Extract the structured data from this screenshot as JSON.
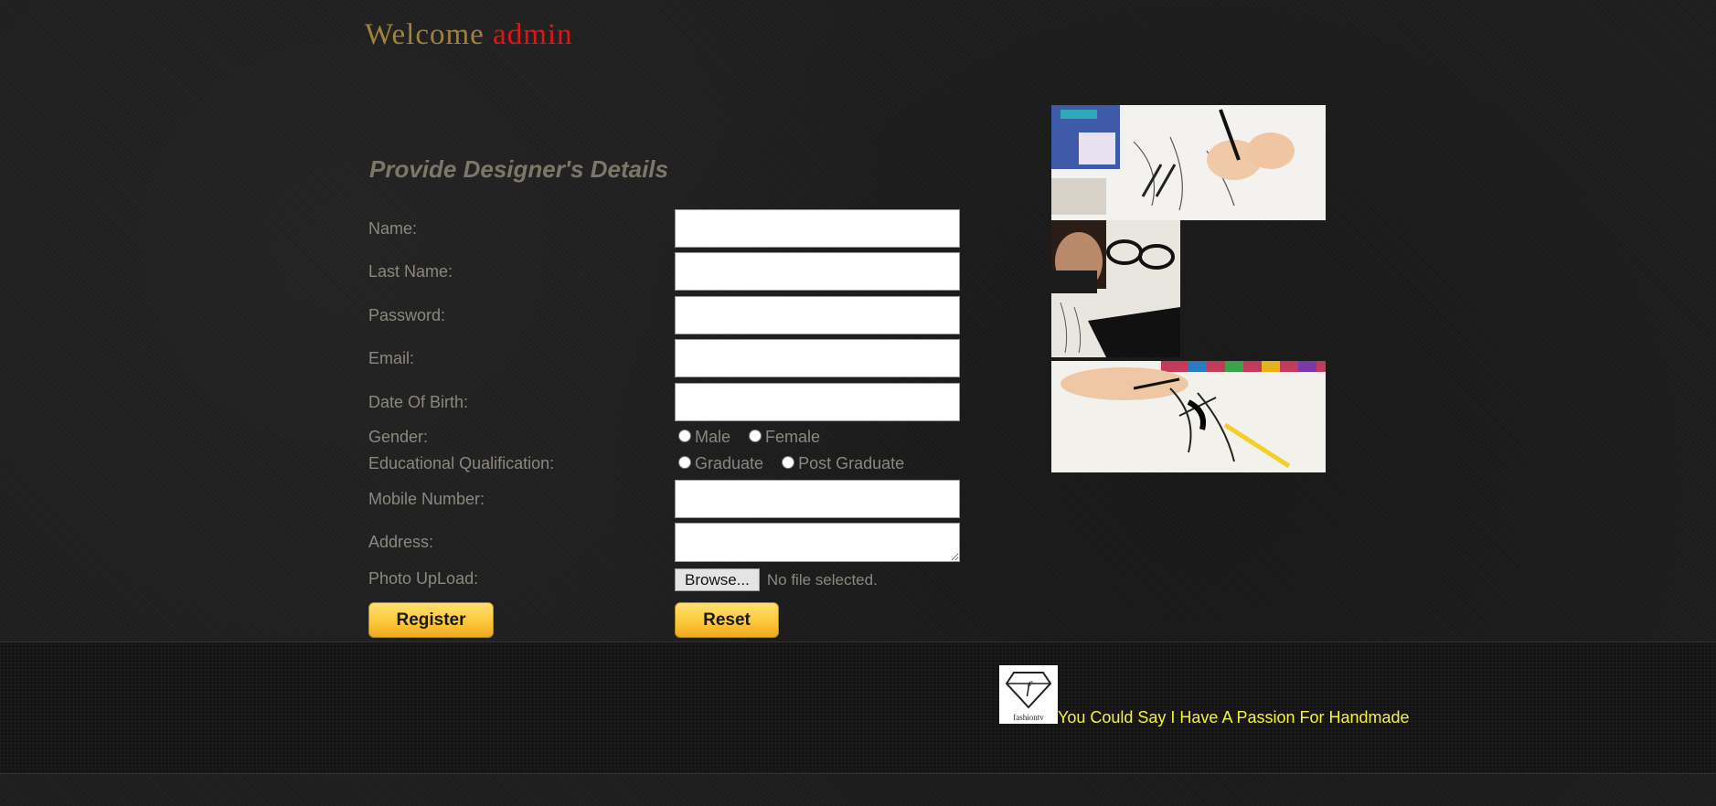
{
  "header": {
    "welcome_prefix": "Welcome",
    "username": "admin"
  },
  "form": {
    "title": "Provide Designer's Details",
    "labels": {
      "name": "Name:",
      "last_name": "Last Name:",
      "password": "Password:",
      "email": "Email:",
      "dob": "Date Of Birth:",
      "gender": "Gender:",
      "education": "Educational Qualification:",
      "mobile": "Mobile Number:",
      "address": "Address:",
      "photo": "Photo UpLoad:"
    },
    "values": {
      "name": "",
      "last_name": "",
      "password": "",
      "email": "",
      "dob": "",
      "mobile": "",
      "address": ""
    },
    "gender_options": [
      "Male",
      "Female"
    ],
    "education_options": [
      "Graduate",
      "Post Graduate"
    ],
    "browse_label": "Browse...",
    "file_status": "No file selected.",
    "register_label": "Register",
    "reset_label": "Reset"
  },
  "footer": {
    "logo_text": "fashiontv",
    "tagline": "You Could Say I Have A Passion For Handmade"
  },
  "colors": {
    "background": "#1e1e1e",
    "welcome": "#a0813d",
    "username": "#e0141a",
    "tagline": "#f5f23a",
    "button_gold": "#fbc93a"
  }
}
